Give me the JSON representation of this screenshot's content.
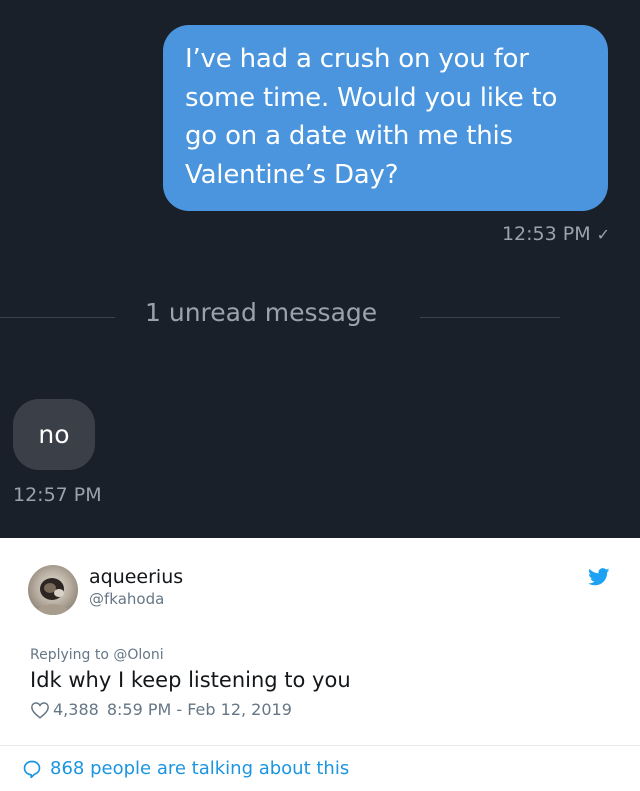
{
  "chat": {
    "outgoing_message": "I’ve had a crush on you for some time. Would you like to go on a date with me this Valentine’s Day?",
    "outgoing_time": "12:53 PM",
    "read_check": "✓",
    "unread_separator": "1 unread message",
    "incoming_message": "no",
    "incoming_time": "12:57 PM"
  },
  "tweet": {
    "display_name": "aqueerius",
    "handle": "@fkahoda",
    "replying_prefix": "Replying to",
    "replying_to": "@Oloni",
    "text": "Idk why I keep listening to you",
    "likes": "4,388",
    "timestamp": "8:59 PM - Feb 12, 2019",
    "talking": "868 people are talking about this"
  },
  "colors": {
    "chat_background": "#19202a",
    "outgoing_bubble": "#4a95dd",
    "incoming_bubble": "#3b4048",
    "twitter_blue": "#1b95e0"
  },
  "icons": {
    "read_receipt": "checkmark-icon",
    "avatar": "avatar-image",
    "brand": "twitter-bird-icon",
    "like": "heart-icon",
    "comment": "speech-bubble-icon"
  }
}
